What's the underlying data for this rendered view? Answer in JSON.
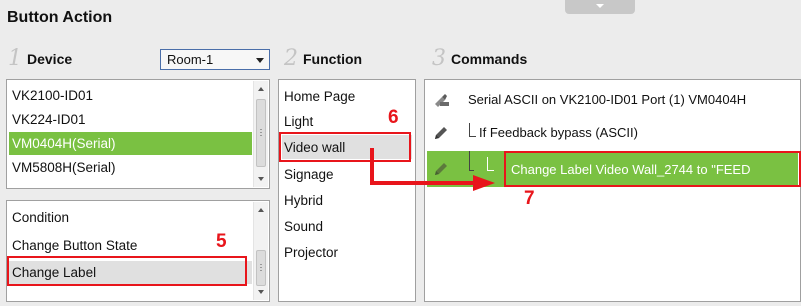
{
  "title": "Button Action",
  "device": {
    "num": "1",
    "header": "Device",
    "room_select": "Room-1",
    "items": [
      "VK2100-ID01",
      "VK224-ID01",
      "VM0404H(Serial)",
      "VM5808H(Serial)"
    ],
    "selected_index": 2
  },
  "actions": {
    "items": [
      "Condition",
      "Change Button State",
      "Change Label"
    ],
    "highlighted_index": 2
  },
  "function": {
    "num": "2",
    "header": "Function",
    "items": [
      "Home Page",
      "Light",
      "Video wall",
      "Signage",
      "Hybrid",
      "Sound",
      "Projector"
    ],
    "highlighted_index": 2
  },
  "commands": {
    "num": "3",
    "header": "Commands",
    "rows": [
      {
        "text": "Serial ASCII on VK2100-ID01 Port (1) VM0404H",
        "icon": "serial-command-icon"
      },
      {
        "text": "If Feedback bypass (ASCII)",
        "icon": "pencil-icon"
      },
      {
        "text": "Change Label Video Wall_2744 to \"FEED",
        "icon": "pencil-icon"
      }
    ],
    "selected_index": 2
  },
  "callouts": [
    "5",
    "6",
    "7"
  ],
  "colors": {
    "selected": "#7ac142",
    "callout": "#e8151b"
  }
}
